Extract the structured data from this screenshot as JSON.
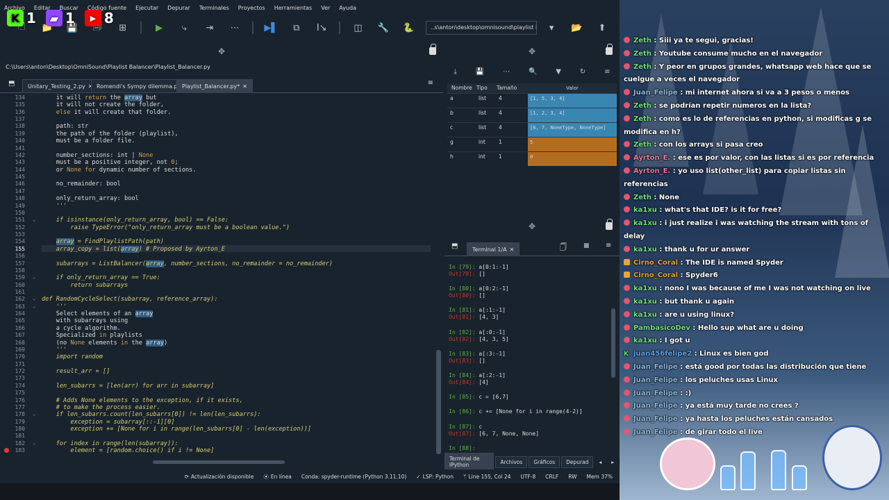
{
  "menu": [
    "Archivo",
    "Editar",
    "Buscar",
    "Código fuente",
    "Ejecutar",
    "Depurar",
    "Terminales",
    "Proyectos",
    "Herramientas",
    "Ver",
    "Ayuda"
  ],
  "toolbar": {
    "path": "..s\\anton\\desktop\\omnisound\\playlist balancer"
  },
  "stream": {
    "kick_count": "1",
    "twitch_count": "1",
    "youtube_count": "8"
  },
  "editor": {
    "file_path": "C:\\Users\\anton\\Desktop\\OmniSound\\Playlist Balancer\\Playlist_Balancer.py",
    "tabs": [
      "Unitary_Testing_2.py",
      "Romendi's Sympy dilemma.py",
      "Playlist_Balancer.py*"
    ],
    "active_tab": 2,
    "lines": [
      {
        "n": "134",
        "t": "    it will return the array but"
      },
      {
        "n": "135",
        "t": "    it will not create the folder,"
      },
      {
        "n": "136",
        "t": "    else it will create that folder."
      },
      {
        "n": "137",
        "t": ""
      },
      {
        "n": "138",
        "t": "    path: str"
      },
      {
        "n": "139",
        "t": "    the path of the folder (playlist),"
      },
      {
        "n": "140",
        "t": "    must be a folder file."
      },
      {
        "n": "141",
        "t": ""
      },
      {
        "n": "142",
        "t": "    number_sections: int | None"
      },
      {
        "n": "143",
        "t": "    must be a positive integer, not 0;"
      },
      {
        "n": "144",
        "t": "    or None for dynamic number of sections."
      },
      {
        "n": "145",
        "t": ""
      },
      {
        "n": "146",
        "t": "    no_remainder: bool"
      },
      {
        "n": "147",
        "t": ""
      },
      {
        "n": "148",
        "t": "    only_return_array: bool"
      },
      {
        "n": "149",
        "t": "    '''"
      },
      {
        "n": "150",
        "t": ""
      },
      {
        "n": "151",
        "t": "    if isinstance(only_return_array, bool) == False:"
      },
      {
        "n": "152",
        "t": "        raise TypeError(\"only_return_array must be a boolean value.\")"
      },
      {
        "n": "153",
        "t": ""
      },
      {
        "n": "154",
        "t": "    array = FindPlaylistPath(path)"
      },
      {
        "n": "155",
        "t": "    array_copy = list(array) # Proposed by Ayrton_E"
      },
      {
        "n": "156",
        "t": ""
      },
      {
        "n": "157",
        "t": "    subarrays = ListBalancer(array, number_sections, no_remainder = no_remainder)"
      },
      {
        "n": "158",
        "t": ""
      },
      {
        "n": "159",
        "t": "    if only_return_array == True:"
      },
      {
        "n": "160",
        "t": "        return subarrays"
      },
      {
        "n": "161",
        "t": ""
      },
      {
        "n": "162",
        "t": "def RandomCycleSelect(subarray, reference_array):"
      },
      {
        "n": "163",
        "t": "    '''"
      },
      {
        "n": "164",
        "t": "    Select elements of an array"
      },
      {
        "n": "165",
        "t": "    with subarrays using"
      },
      {
        "n": "166",
        "t": "    a cycle algorithm."
      },
      {
        "n": "167",
        "t": "    Specialized in playlists"
      },
      {
        "n": "168",
        "t": "    (no None elements in the array)"
      },
      {
        "n": "169",
        "t": "    '''"
      },
      {
        "n": "170",
        "t": "    import random"
      },
      {
        "n": "171",
        "t": ""
      },
      {
        "n": "172",
        "t": "    result_arr = []"
      },
      {
        "n": "173",
        "t": ""
      },
      {
        "n": "174",
        "t": "    len_subarrs = [len(arr) for arr in subarray]"
      },
      {
        "n": "175",
        "t": ""
      },
      {
        "n": "176",
        "t": "    # Adds None elements to the exception, if it exists,"
      },
      {
        "n": "177",
        "t": "    # to make the process easier."
      },
      {
        "n": "178",
        "t": "    if len_subarrs.count(len_subarrs[0]) != len(len_subarrs):"
      },
      {
        "n": "179",
        "t": "        exception = subarray[::-1][0]"
      },
      {
        "n": "180",
        "t": "        exception += [None for i in range(len_subarrs[0] - len(exception))]"
      },
      {
        "n": "181",
        "t": ""
      },
      {
        "n": "182",
        "t": "    for index in range(len(subarray)):"
      },
      {
        "n": "183",
        "t": "        element = [random.choice() if i != None]"
      }
    ]
  },
  "variables": {
    "headers": [
      "Nombre",
      "Tipo",
      "Tamaño",
      "Valor"
    ],
    "rows": [
      {
        "name": "a",
        "type": "list",
        "size": "4",
        "value": "[1, 5, 3, 4]",
        "color": "#3a86b3"
      },
      {
        "name": "b",
        "type": "list",
        "size": "4",
        "value": "[1, 2, 3, 4]",
        "color": "#3a86b3"
      },
      {
        "name": "c",
        "type": "list",
        "size": "4",
        "value": "[6, 7, NoneType, NoneType]",
        "color": "#3a86b3"
      },
      {
        "name": "g",
        "type": "int",
        "size": "1",
        "value": "5",
        "color": "#b46c1e"
      },
      {
        "name": "h",
        "type": "int",
        "size": "1",
        "value": "0",
        "color": "#b46c1e"
      }
    ]
  },
  "terminal": {
    "tab": "Terminal 1/A",
    "entries": [
      {
        "in": "In [79]: ",
        "code": "a[0:1:-1]",
        "out": "Out[79]: ",
        "res": "[]"
      },
      {
        "in": "In [80]: ",
        "code": "a[0:2:-1]",
        "out": "Out[80]: ",
        "res": "[]"
      },
      {
        "in": "In [81]: ",
        "code": "a[:1:-1]",
        "out": "Out[81]: ",
        "res": "[4, 3]"
      },
      {
        "in": "In [82]: ",
        "code": "a[:0:-1]",
        "out": "Out[82]: ",
        "res": "[4, 3, 5]"
      },
      {
        "in": "In [83]: ",
        "code": "a[:3:-1]",
        "out": "Out[83]: ",
        "res": "[]"
      },
      {
        "in": "In [84]: ",
        "code": "a[:2:-1]",
        "out": "Out[84]: ",
        "res": "[4]"
      },
      {
        "in": "In [85]: ",
        "code": "c = [6,7]",
        "out": "",
        "res": ""
      },
      {
        "in": "In [86]: ",
        "code": "c += [None for i in range(4-2)]",
        "out": "",
        "res": ""
      },
      {
        "in": "In [87]: ",
        "code": "c",
        "out": "Out[87]: ",
        "res": "[6, 7, None, None]"
      },
      {
        "in": "In [88]: ",
        "code": "",
        "out": "",
        "res": ""
      }
    ],
    "bottom_tabs": [
      "Terminal de IPython",
      "Archivos",
      "Gráficos",
      "Depurad"
    ]
  },
  "status": {
    "update": "Actualización disponible",
    "online": "En línea",
    "conda": "Conda: spyder-runtime (Python 3.11.10)",
    "lsp": "LSP: Python",
    "pos": "Line 155, Col 24",
    "enc": "UTF-8",
    "eol": "CRLF",
    "rw": "RW",
    "mem": "Mem 37%"
  },
  "chat": [
    {
      "user": "Zeth",
      "color": "#6fe07a",
      "text": "Siii ya te segui, gracias!",
      "icon": "dot"
    },
    {
      "user": "Zeth",
      "color": "#6fe07a",
      "text": "Youtube consume mucho en el navegador",
      "icon": "dot"
    },
    {
      "user": "Zeth",
      "color": "#6fe07a",
      "text": "Y peor en grupos grandes, whatsapp web hace que se cuelgue a veces el navegador",
      "icon": "dot"
    },
    {
      "user": "Juan_Felipe",
      "color": "#8bb7d8",
      "text": "mi internet ahora si va a 3 pesos o menos",
      "icon": "dot"
    },
    {
      "user": "Zeth",
      "color": "#6fe07a",
      "text": "se podrían repetir numeros en la lista?",
      "icon": "dot"
    },
    {
      "user": "Zeth",
      "color": "#6fe07a",
      "text": "como es lo de referencias en python, si modificas g se modifica en h?",
      "icon": "dot"
    },
    {
      "user": "Zeth",
      "color": "#6fe07a",
      "text": "con los arrays si pasa creo",
      "icon": "dot"
    },
    {
      "user": "Ayrton_E.",
      "color": "#e77b9b",
      "text": "ese es por valor, con las listas si es por referencia",
      "icon": "dot"
    },
    {
      "user": "Ayrton_E.",
      "color": "#e77b9b",
      "text": "yo uso list(other_list) para copiar listas sin referencias",
      "icon": "dot"
    },
    {
      "user": "Zeth",
      "color": "#6fe07a",
      "text": "None",
      "icon": "dot"
    },
    {
      "user": "ka1xu",
      "color": "#6fe07a",
      "text": "what's that IDE? is it for free?",
      "icon": "dot"
    },
    {
      "user": "ka1xu",
      "color": "#6fe07a",
      "text": "i just realize i was watching the stream with tons of delay",
      "icon": "dot"
    },
    {
      "user": "ka1xu",
      "color": "#6fe07a",
      "text": "thank u for ur answer",
      "icon": "dot"
    },
    {
      "user": "Cirno_Coral",
      "color": "#e8a53a",
      "text": "The IDE is named Spyder",
      "icon": "badge"
    },
    {
      "user": "Cirno_Coral",
      "color": "#e8a53a",
      "text": "Spyder6",
      "icon": "badge"
    },
    {
      "user": "ka1xu",
      "color": "#6fe07a",
      "text": "nono I was because of me I was not watching on live",
      "icon": "dot"
    },
    {
      "user": "ka1xu",
      "color": "#6fe07a",
      "text": "but thank u again",
      "icon": "dot"
    },
    {
      "user": "ka1xu",
      "color": "#6fe07a",
      "text": "are u using linux?",
      "icon": "dot"
    },
    {
      "user": "PambasicoDev",
      "color": "#6fe07a",
      "text": "Hello sup what are u doing",
      "icon": "dot"
    },
    {
      "user": "ka1xu",
      "color": "#6fe07a",
      "text": "I got u",
      "icon": "dot"
    },
    {
      "user": "juan456felipe2",
      "color": "#5ea0e0",
      "text": "Linux es bien god",
      "icon": "kick"
    },
    {
      "user": "Juan_Felipe",
      "color": "#8bb7d8",
      "text": "está good por todas las distribución que tiene",
      "icon": "dot"
    },
    {
      "user": "Juan_Felipe",
      "color": "#8bb7d8",
      "text": "los peluches usas Linux",
      "icon": "dot"
    },
    {
      "user": "Juan_Felipe",
      "color": "#8bb7d8",
      "text": ":)",
      "icon": "dot"
    },
    {
      "user": "Juan_Felipe",
      "color": "#8bb7d8",
      "text": "ya está muy tarde no crees ?",
      "icon": "dot"
    },
    {
      "user": "Juan_Felipe",
      "color": "#8bb7d8",
      "text": "ya hasta los peluches están cansados",
      "icon": "dot"
    },
    {
      "user": "Juan_Felipe",
      "color": "#8bb7d8",
      "text": "de girar todo el live",
      "icon": "dot"
    }
  ]
}
